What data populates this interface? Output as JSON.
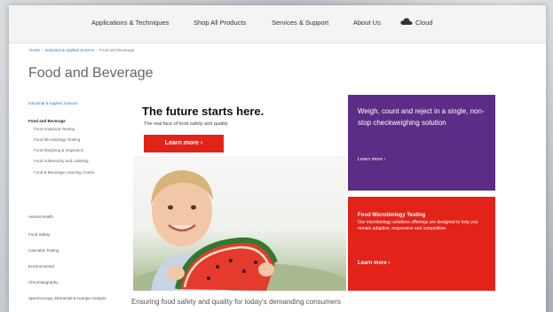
{
  "nav": {
    "items": [
      "Applications & Techniques",
      "Shop All Products",
      "Services & Support",
      "About Us"
    ],
    "cloud_label": "Cloud"
  },
  "breadcrumb": [
    "Home",
    "Industrial & Applied Science",
    "Food and Beverage"
  ],
  "page_title": "Food and Beverage",
  "sidebar": {
    "parent": "Industrial & Applied Science",
    "section": "Food and Beverage",
    "subitems": [
      "Food Analytical Testing",
      "Food Microbiology Testing",
      "Food Weighing & Inspection",
      "Food Authenticity and Labeling",
      "Food & Beverage Learning Centre"
    ],
    "others": [
      "Animal Health",
      "Food Safety",
      "Cannabis Testing",
      "Environmental",
      "Chromatography",
      "Spectroscopy, Elemental & Isotope Analysis"
    ]
  },
  "hero": {
    "headline": "The future starts here.",
    "subtext": "The real face of food safety and quality",
    "button": "Learn more ›"
  },
  "promo_purple": {
    "text": "Weigh, count and reject in a single, non-stop checkweighing solution",
    "link": "Learn more ›"
  },
  "promo_red": {
    "title": "Food Microbiology Testing",
    "text": "Our microbiology solutions offerings are designed to help you remain adaptive, responsive and competitive.",
    "link": "Learn more ›"
  },
  "footer_text": "Ensuring food safety and quality for today's demanding consumers",
  "colors": {
    "accent_red": "#e2231a",
    "promo_purple": "#5b2d86",
    "link_blue": "#3a76b7"
  }
}
